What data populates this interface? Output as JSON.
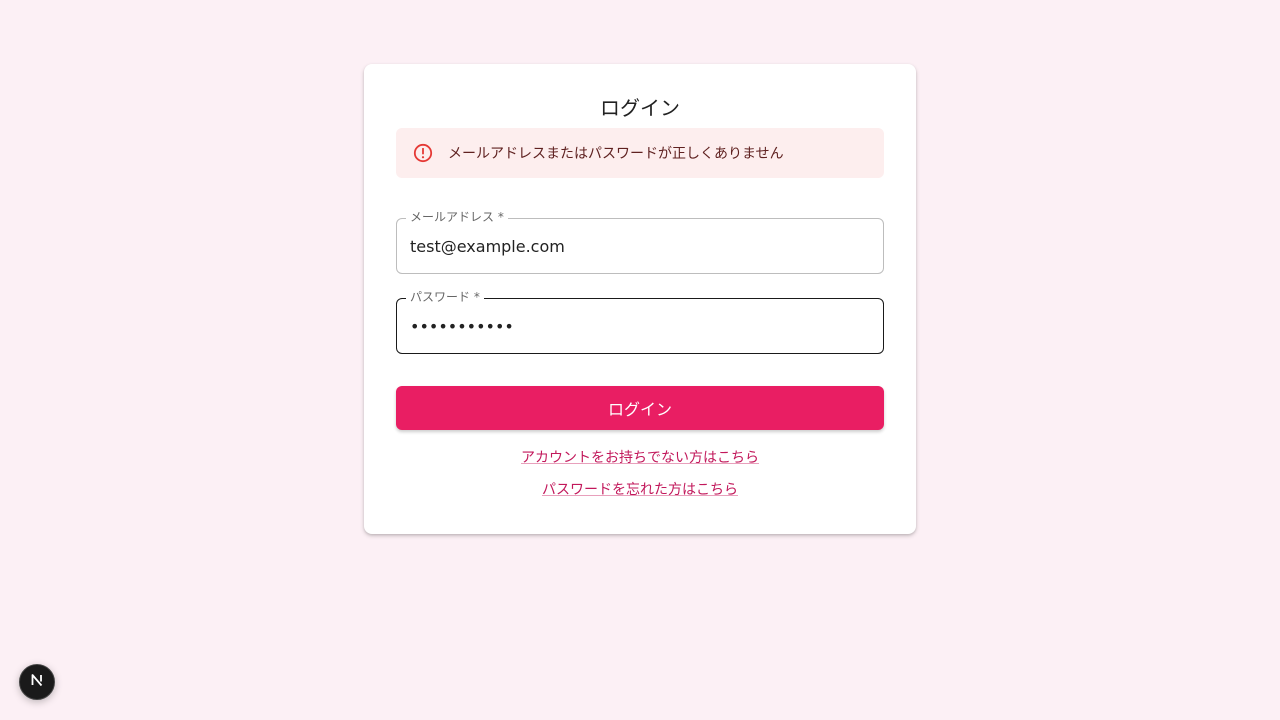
{
  "login": {
    "title": "ログイン",
    "error": {
      "icon": "error-outline-icon",
      "color": "#e53935",
      "message": "メールアドレスまたはパスワードが正しくありません"
    },
    "email": {
      "label": "メールアドレス *",
      "value": "test@example.com"
    },
    "password": {
      "label": "パスワード *",
      "value": "•••••••••••"
    },
    "submit_label": "ログイン",
    "accent_color": "#e91e63",
    "signup_link": "アカウントをお持ちでない方はこちら",
    "forgot_link": "パスワードを忘れた方はこちら"
  },
  "dev_badge": {
    "icon": "nextjs-logo-icon"
  }
}
